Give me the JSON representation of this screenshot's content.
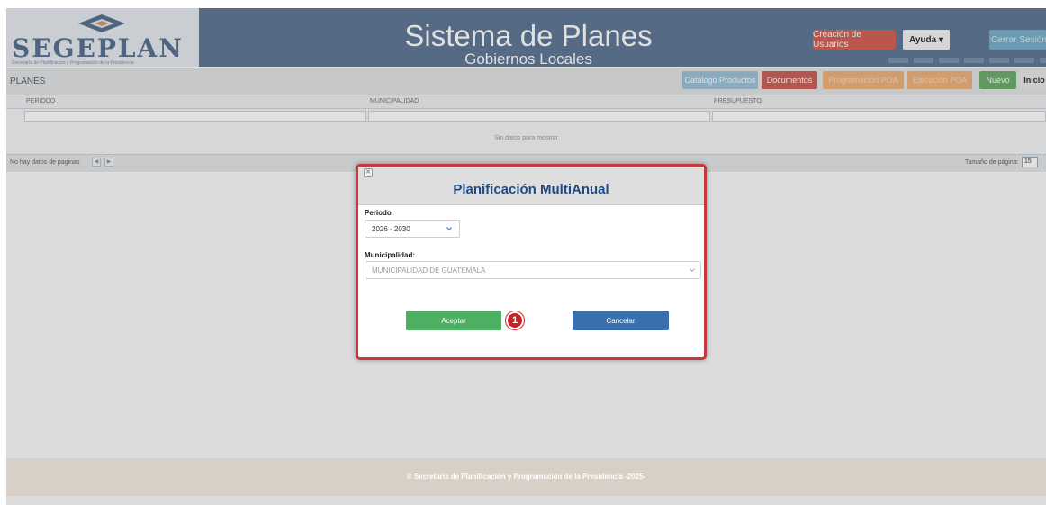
{
  "header": {
    "logo_text": "SEGEPLAN",
    "logo_subtitle": "Secretaría de Planificación y Programación de la Presidencia",
    "title": "Sistema de Planes",
    "subtitle": "Gobiernos Locales",
    "buttons": {
      "creacion_usuarios": "Creación de Usuarios",
      "ayuda": "Ayuda ▾",
      "cerrar_sesion": "Cerrar Sesión"
    }
  },
  "toolbar": {
    "section_label": "PLANES",
    "buttons": {
      "catalogo": "Catálogo Productos",
      "documentos": "Documentos",
      "programacion": "Programación POA",
      "ejecucion": "Ejecución POA",
      "nuevo": "Nuevo",
      "inicio": "Inicio"
    }
  },
  "grid": {
    "columns": [
      "PERIODO",
      "MUNICIPALIDAD",
      "PRESUPUESTO"
    ],
    "empty_text": "Sin datos para mostrar",
    "pager_text": "No hay datos de paginas",
    "page_size_label": "Tamaño de página:",
    "page_size": "15"
  },
  "modal": {
    "title": "Planificación MultiAnual",
    "periodo_label": "Periodo",
    "periodo_value": "2026 - 2030",
    "municipalidad_label": "Municipalidad:",
    "municipalidad_value": "MUNICIPALIDAD DE GUATEMALA",
    "aceptar": "Aceptar",
    "cancelar": "Cancelar",
    "step_number": "1"
  },
  "footer": {
    "text": "© Secretaría de Planificación y Programación de la Presidencia -2025-"
  },
  "colors": {
    "header_band": "#617997",
    "modal_border": "#c4393b",
    "accept_green": "#4caf62",
    "cancel_blue": "#3a6fae",
    "title_blue": "#1f4a86"
  }
}
